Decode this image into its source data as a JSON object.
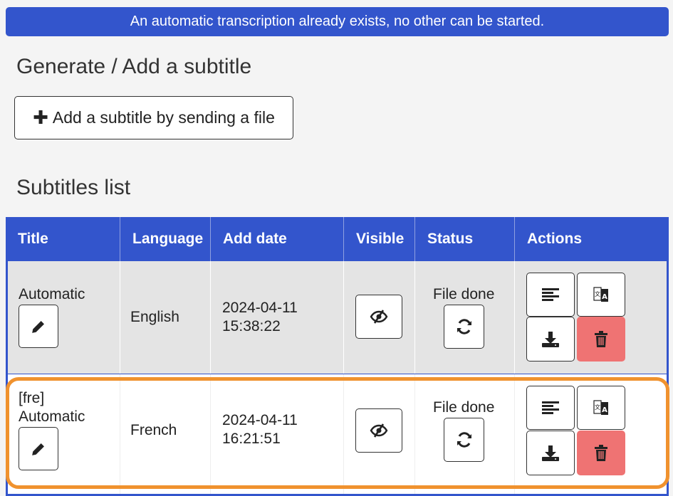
{
  "banner": {
    "text": "An automatic transcription already exists, no other can be started."
  },
  "generate_section": {
    "title": "Generate / Add a subtitle",
    "add_button_label": "Add a subtitle by sending a file"
  },
  "list_section": {
    "title": "Subtitles list"
  },
  "table": {
    "columns": [
      "Title",
      "Language",
      "Add date",
      "Visible",
      "Status",
      "Actions"
    ],
    "rows": [
      {
        "title": "Automatic",
        "language": "English",
        "add_date": "2024-04-11\n15:38:22",
        "status": "File done"
      },
      {
        "title": "[fre]\nAutomatic",
        "language": "French",
        "add_date": "2024-04-11\n16:21:51",
        "status": "File done"
      }
    ]
  },
  "colors": {
    "accent": "#3355cc",
    "danger": "#ef7373",
    "highlight": "#f0922e"
  },
  "icons": {
    "add": "plus-icon",
    "edit": "pencil-icon",
    "visible": "eye-slash-icon",
    "refresh": "refresh-icon",
    "view": "align-left-icon",
    "translate": "translate-icon",
    "download": "download-icon",
    "delete": "trash-icon"
  }
}
